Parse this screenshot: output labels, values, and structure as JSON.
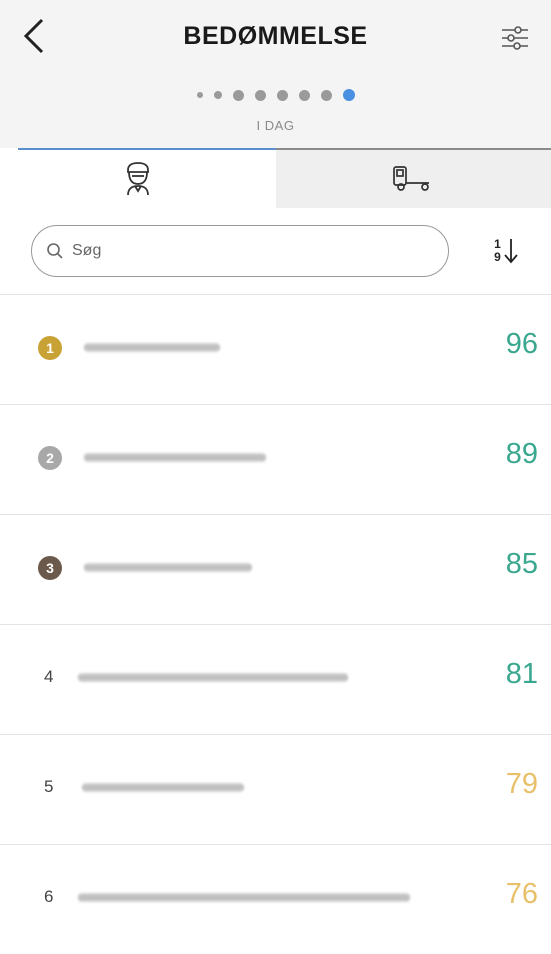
{
  "header": {
    "title": "BEDØMMELSE",
    "period_label": "I DAG",
    "period_dots": 8,
    "active_dot_index": 7
  },
  "tabs": [
    {
      "icon": "driver-icon",
      "active": true
    },
    {
      "icon": "truck-icon",
      "active": false
    }
  ],
  "search": {
    "placeholder": "Søg",
    "value": ""
  },
  "sort": {
    "top": "1",
    "bottom": "9",
    "direction": "descending"
  },
  "colors": {
    "accent": "#4a90e2",
    "score_high": "#3aa78f",
    "score_mid": "#e8c06a",
    "gold": "#c9a236",
    "silver": "#a8a8a8",
    "bronze": "#6b5a4c"
  },
  "drivers": [
    {
      "rank": "1",
      "name": "",
      "score": "96",
      "score_level": "high",
      "medal": "gold"
    },
    {
      "rank": "2",
      "name": "",
      "score": "89",
      "score_level": "high",
      "medal": "silver"
    },
    {
      "rank": "3",
      "name": "",
      "score": "85",
      "score_level": "high",
      "medal": "bronze"
    },
    {
      "rank": "4",
      "name": "",
      "score": "81",
      "score_level": "high",
      "medal": ""
    },
    {
      "rank": "5",
      "name": "",
      "score": "79",
      "score_level": "mid",
      "medal": ""
    },
    {
      "rank": "6",
      "name": "",
      "score": "76",
      "score_level": "mid",
      "medal": ""
    }
  ]
}
